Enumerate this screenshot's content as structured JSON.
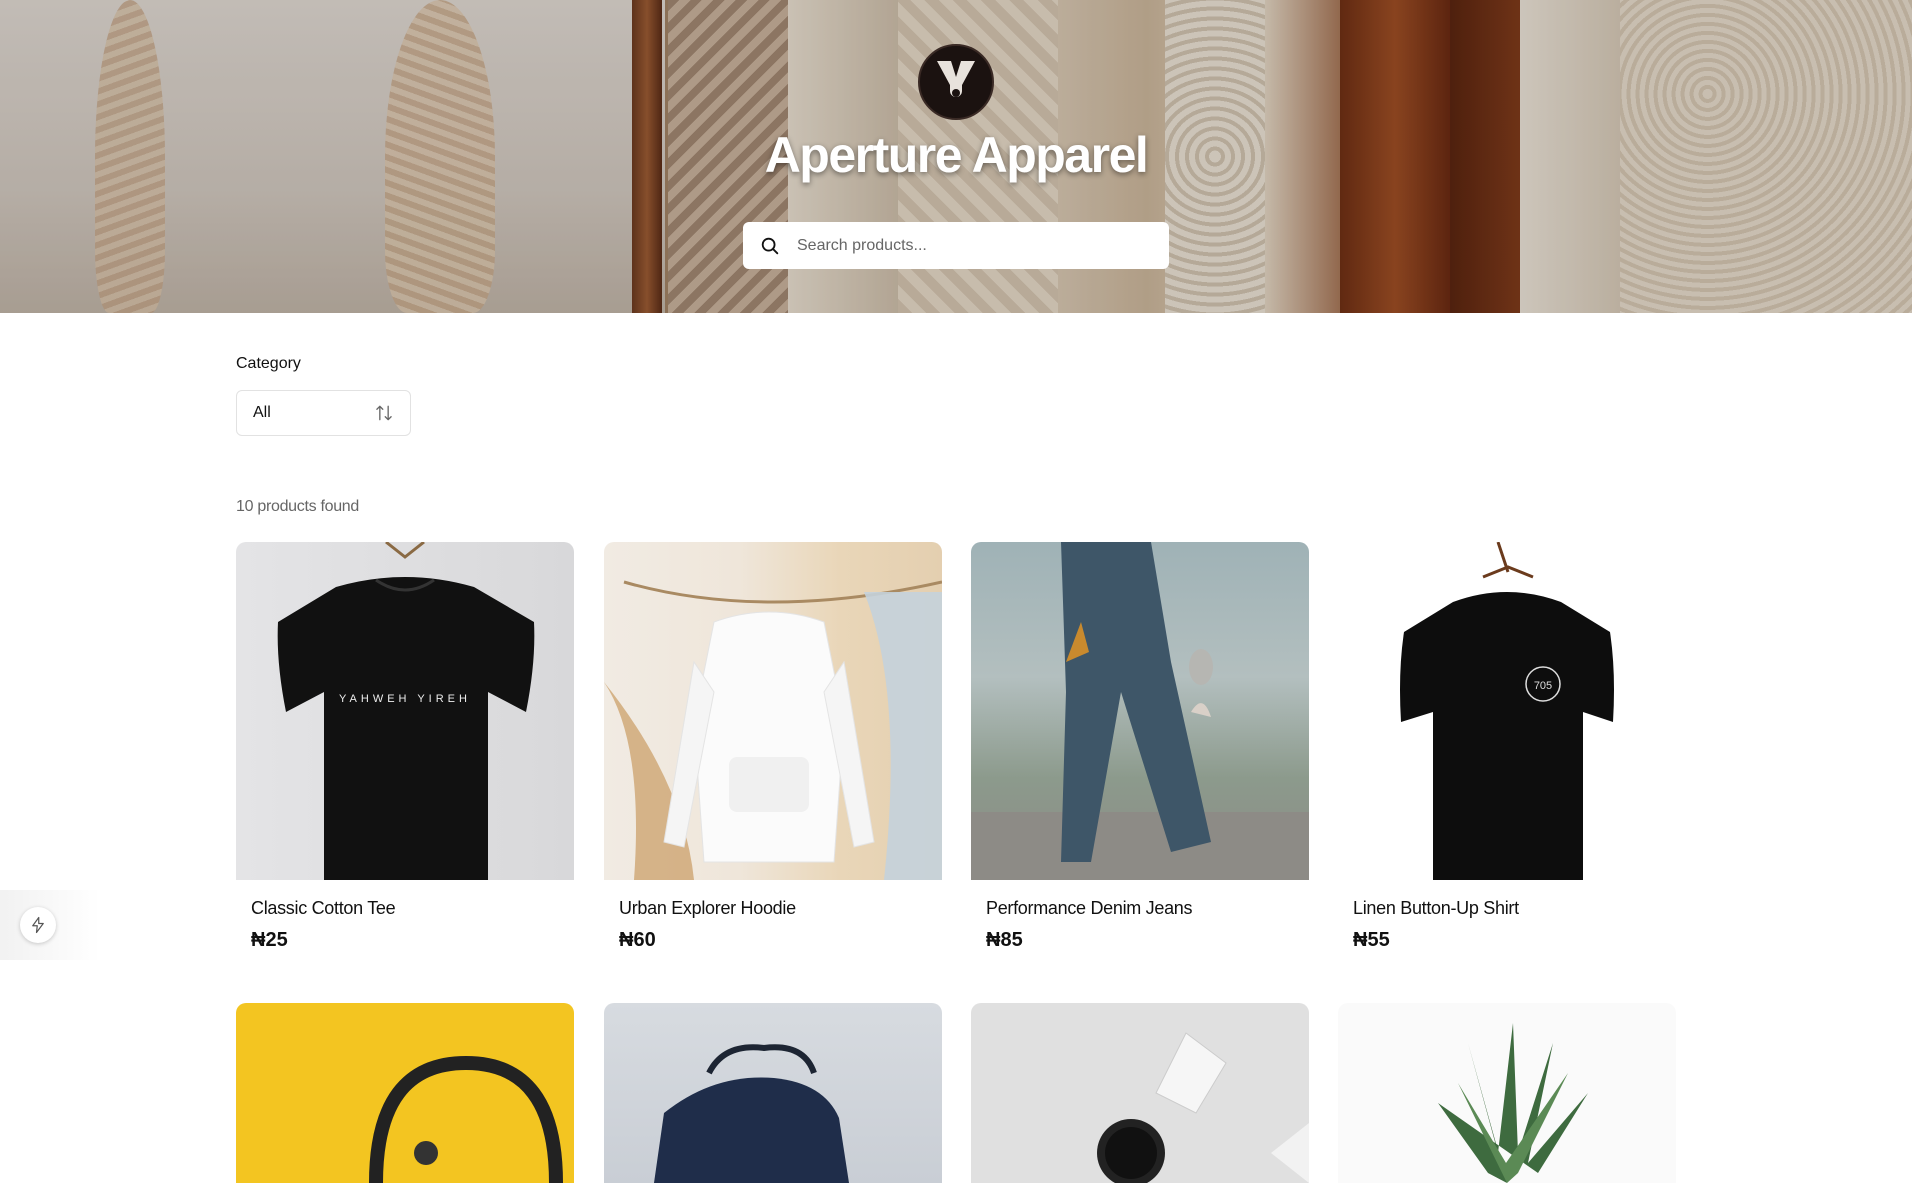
{
  "brand": {
    "title": "Aperture Apparel"
  },
  "search": {
    "placeholder": "Search products..."
  },
  "filters": {
    "category_label": "Category",
    "category_value": "All"
  },
  "results": {
    "count_text": "10 products found"
  },
  "products": [
    {
      "name": "Classic Cotton Tee",
      "price": "₦25"
    },
    {
      "name": "Urban Explorer Hoodie",
      "price": "₦60"
    },
    {
      "name": "Performance Denim Jeans",
      "price": "₦85"
    },
    {
      "name": "Linen Button-Up Shirt",
      "price": "₦55"
    },
    {
      "name": "",
      "price": ""
    },
    {
      "name": "",
      "price": ""
    },
    {
      "name": "",
      "price": ""
    },
    {
      "name": "",
      "price": ""
    }
  ],
  "tee_print": "YAHWEH YIREH",
  "badge_print": "705",
  "colors": {
    "hero_title": "#ffffff",
    "muted_text": "#666666",
    "accent_yellow": "#f3c521"
  },
  "icons": {
    "search": "search-icon",
    "sort": "sort-arrows-icon",
    "logo": "logo-y-icon",
    "side": "lightning-icon"
  }
}
